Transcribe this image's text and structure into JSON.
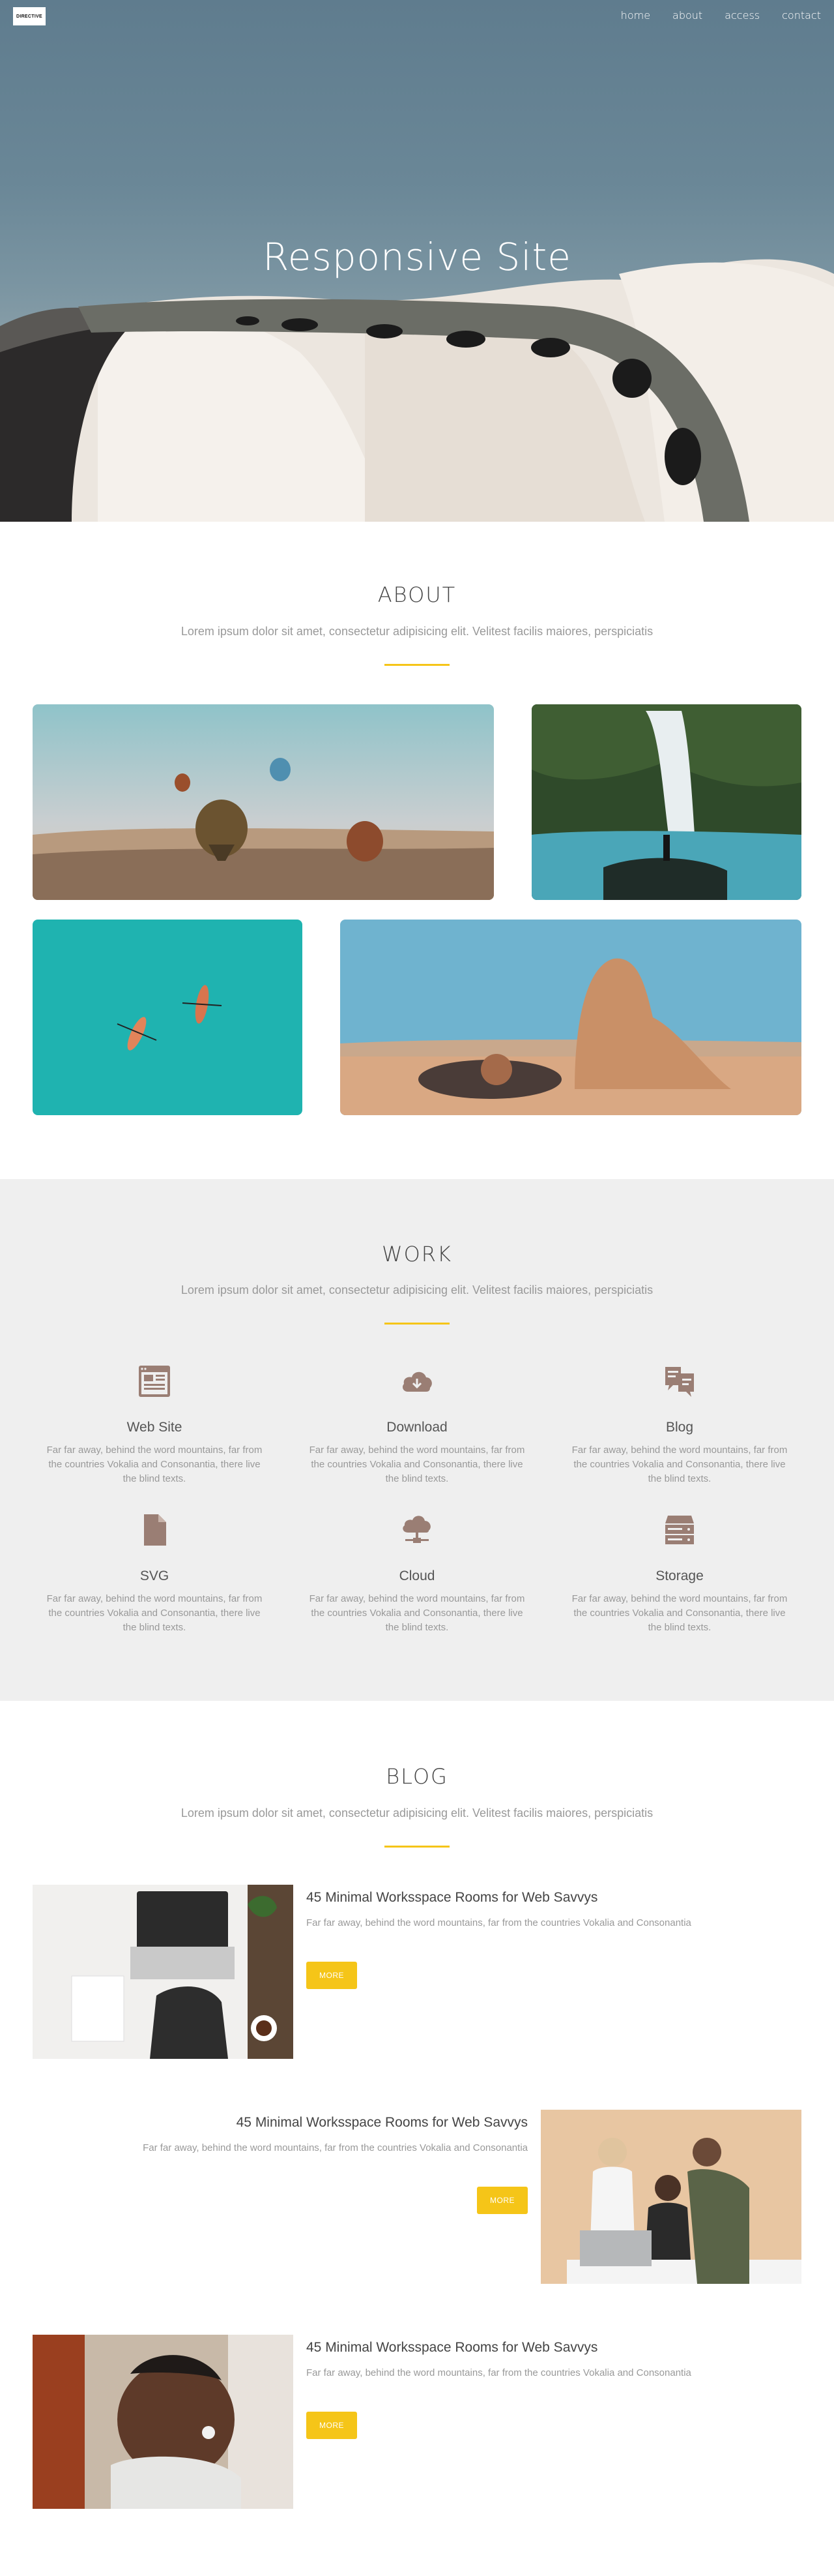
{
  "header": {
    "logo": "DIRECTIVE",
    "nav": [
      "home",
      "about",
      "access",
      "contact"
    ]
  },
  "hero": {
    "title": "Responsive Site"
  },
  "about": {
    "title": "ABOUT",
    "subtitle": "Lorem ipsum dolor sit amet, consectetur adipisicing elit. Velitest facilis maiores, perspiciatis"
  },
  "work": {
    "title": "WORK",
    "subtitle": "Lorem ipsum dolor sit amet, consectetur adipisicing elit. Velitest facilis maiores, perspiciatis",
    "items": [
      {
        "title": "Web Site",
        "icon": "browser-icon",
        "text": "Far far away, behind the word mountains, far from the countries Vokalia and Consonantia, there live the blind texts."
      },
      {
        "title": "Download",
        "icon": "cloud-download-icon",
        "text": "Far far away, behind the word mountains, far from the countries Vokalia and Consonantia, there live the blind texts."
      },
      {
        "title": "Blog",
        "icon": "blog-icon",
        "text": "Far far away, behind the word mountains, far from the countries Vokalia and Consonantia, there live the blind texts."
      },
      {
        "title": "SVG",
        "icon": "file-icon",
        "text": "Far far away, behind the word mountains, far from the countries Vokalia and Consonantia, there live the blind texts."
      },
      {
        "title": "Cloud",
        "icon": "cloud-network-icon",
        "text": "Far far away, behind the word mountains, far from the countries Vokalia and Consonantia, there live the blind texts."
      },
      {
        "title": "Storage",
        "icon": "storage-icon",
        "text": "Far far away, behind the word mountains, far from the countries Vokalia and Consonantia, there live the blind texts."
      }
    ]
  },
  "blog": {
    "title": "BLOG",
    "subtitle": "Lorem ipsum dolor sit amet, consectetur adipisicing elit. Velitest facilis maiores, perspiciatis",
    "posts": [
      {
        "title": "45 Minimal Worksspace Rooms for Web Savvys",
        "text": "Far far away, behind the word mountains, far from the countries Vokalia and Consonantia",
        "button": "MORE"
      },
      {
        "title": "45 Minimal Worksspace Rooms for Web Savvys",
        "text": "Far far away, behind the word mountains, far from the countries Vokalia and Consonantia",
        "button": "MORE"
      },
      {
        "title": "45 Minimal Worksspace Rooms for Web Savvys",
        "text": "Far far away, behind the word mountains, far from the countries Vokalia and Consonantia",
        "button": "MORE"
      }
    ]
  },
  "colors": {
    "accent": "#f5c518",
    "icon": "#9a7e74",
    "work_bg": "#efefef"
  }
}
